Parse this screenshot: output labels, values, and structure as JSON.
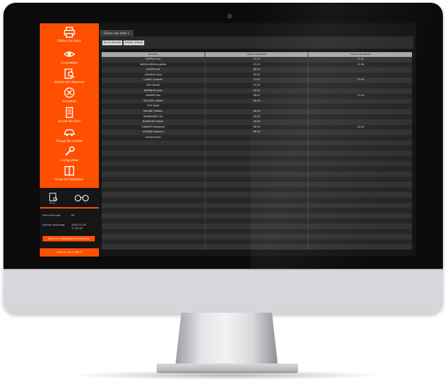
{
  "sidebar": {
    "items": [
      {
        "label": "Édition des états",
        "icon": "printer-icon"
      },
      {
        "label": "Convertibles",
        "icon": "eye-icon"
      },
      {
        "label": "Gestion des dépenses",
        "icon": "clipboard-search-icon"
      },
      {
        "label": "Annulation",
        "icon": "cancel-circle-icon"
      },
      {
        "label": "Journal de ticket",
        "icon": "receipt-icon"
      },
      {
        "label": "Groupe de contrôle",
        "icon": "car-icon"
      },
      {
        "label": "Configuration",
        "icon": "wrench-icon"
      },
      {
        "label": "Guide de l'utilisateur",
        "icon": "book-icon"
      }
    ],
    "bottom": {
      "icon_left": "users-device-icon",
      "icon_left_label": "Mobile",
      "icon_right": "glasses-icon",
      "status_label": "Etat archivage",
      "status_value": "OK",
      "last_label": "Dernier archivage",
      "last_value_line1": "2016-10-18",
      "last_value_line2": "17:33:49",
      "force_button": "Forcer le chargement de l'archive",
      "datetime": "2016-10-18 17:38:22"
    }
  },
  "main": {
    "tab": "Édition des états ✕",
    "toolbar": {
      "btn_1": "Sur la journée",
      "btn_2": "Édition d'états"
    },
    "table": {
      "headers": [
        "Salariés",
        "Heure d'arrivée",
        "Heure de départ"
      ],
      "rows": [
        [
          "CAPPRA Yvan",
          "07:15",
          "17:01"
        ],
        [
          "BASSILLERON Aurélien",
          "07:11",
          "17:00"
        ],
        [
          "LAGIER Julie",
          "06:15",
          ""
        ],
        [
          "CREVAUX Alain",
          "09:07",
          ""
        ],
        [
          "LAURET Isabelle",
          "07:51",
          "17:05"
        ],
        [
          "FAIX Daniel",
          "07:22",
          ""
        ],
        [
          "BARRAUD Jonas",
          "09:10",
          ""
        ],
        [
          "HAIDER Elsa",
          "08:47",
          "11:44"
        ],
        [
          "SOLOTER Valérie",
          "08:29",
          ""
        ],
        [
          "TOH Abdel",
          "",
          ""
        ],
        [
          "MAGNIR Frédéric",
          "08:29",
          ""
        ],
        [
          "RAHMENDEZ Sid",
          "09:02",
          ""
        ],
        [
          "BLANCHET Fabien",
          "09:05",
          ""
        ],
        [
          "VIANNOS Mohamed",
          "08:47",
          "11:44"
        ],
        [
          "LIOVARD Delphine",
          "08:23",
          ""
        ],
        [
          "Viviane Julien",
          "",
          ""
        ]
      ]
    }
  }
}
